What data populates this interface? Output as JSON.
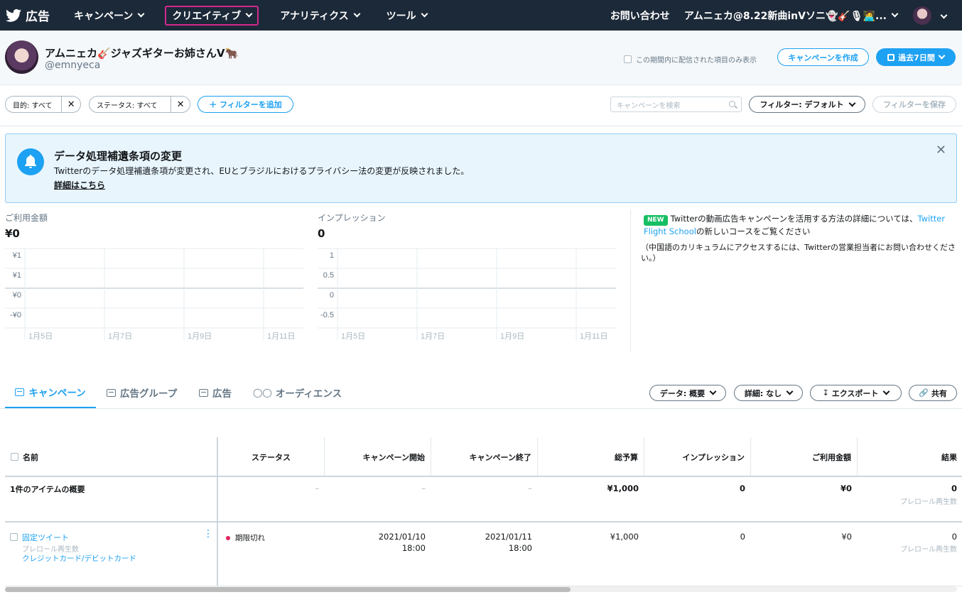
{
  "nav": {
    "brand": "広告",
    "items": [
      "キャンペーン",
      "クリエイティブ",
      "アナリティクス",
      "ツール"
    ],
    "contact": "お問い合わせ",
    "account": "アムニェカ@8.22新曲inVソニ👻🎸🎙🧑‍💻..."
  },
  "header": {
    "name": "アムニェカ🎸ジャズギターお姉さんV🐂",
    "handle": "@emnyeca",
    "period_checkbox": "この期間内に配信された項目のみ表示",
    "create_campaign": "キャンペーンを作成",
    "date_range": "過去7日間"
  },
  "filters": {
    "objective": "目的: すべて",
    "status": "ステータス: すべて",
    "clear": "✕",
    "add_filter": "＋ フィルターを追加",
    "search_placeholder": "キャンペーンを検索",
    "filter_default": "フィルター: デフォルト",
    "save_filter": "フィルターを保存"
  },
  "notice": {
    "title": "データ処理補遺条項の変更",
    "body": "Twitterのデータ処理補遺条項が変更され、EUとブラジルにおけるプライバシー法の変更が反映されました。",
    "link": "詳細はこちら",
    "close": "✕"
  },
  "metrics": {
    "spend_label": "ご利用金額",
    "spend_value": "¥0",
    "impressions_label": "インプレッション",
    "impressions_value": "0"
  },
  "chart_data": [
    {
      "type": "line",
      "title": "ご利用金額",
      "x": [
        "1月5日",
        "1月7日",
        "1月9日",
        "1月11日"
      ],
      "y_ticks": [
        "¥1",
        "¥1",
        "¥0",
        "-¥0"
      ],
      "series": [
        {
          "values": [
            0,
            0,
            0,
            0
          ]
        }
      ],
      "grid": true
    },
    {
      "type": "line",
      "title": "インプレッション",
      "x": [
        "1月5日",
        "1月7日",
        "1月9日",
        "1月11日"
      ],
      "y_ticks": [
        "1",
        "0.5",
        "0",
        "-0.5"
      ],
      "series": [
        {
          "values": [
            0,
            0,
            0,
            0
          ]
        }
      ],
      "grid": true
    }
  ],
  "promo": {
    "badge": "NEW",
    "text_before": "Twitterの動画広告キャンペーンを活用する方法の詳細については、",
    "link": "Twitter Flight School",
    "text_after": "の新しいコースをご覧ください",
    "note": "（中国語のカリキュラムにアクセスするには、Twitterの営業担当者にお問い合わせください。）"
  },
  "tabs": [
    "キャンペーン",
    "広告グループ",
    "広告",
    "オーディエンス"
  ],
  "table_controls": {
    "data": "データ: 概要",
    "detail": "詳細: なし",
    "export": "エクスポート",
    "share": "共有"
  },
  "table": {
    "columns": [
      "名前",
      "ステータス",
      "キャンペーン開始",
      "キャンペーン終了",
      "総予算",
      "インプレッション",
      "ご利用金額",
      "結果"
    ],
    "summary": {
      "name": "1件のアイテムの概要",
      "status": "–",
      "start": "–",
      "end": "–",
      "budget": "¥1,000",
      "impressions": "0",
      "spend": "¥0",
      "results": "0",
      "results_sub": "プレロール再生数"
    },
    "rows": [
      {
        "name": "固定ツイート",
        "sub1": "プレロール再生数",
        "sub2": "クレジットカード/デビットカード",
        "status": "期限切れ",
        "start_date": "2021/01/10",
        "start_time": "18:00",
        "end_date": "2021/01/11",
        "end_time": "18:00",
        "budget": "¥1,000",
        "impressions": "0",
        "spend": "¥0",
        "results": "0",
        "results_sub": "プレロール再生数"
      }
    ]
  },
  "colors": {
    "nav_bg": "#1c2938",
    "accent": "#1da1f2",
    "active_outline": "#d4298e",
    "status_expired": "#e0245e",
    "new_badge": "#17bf63"
  }
}
